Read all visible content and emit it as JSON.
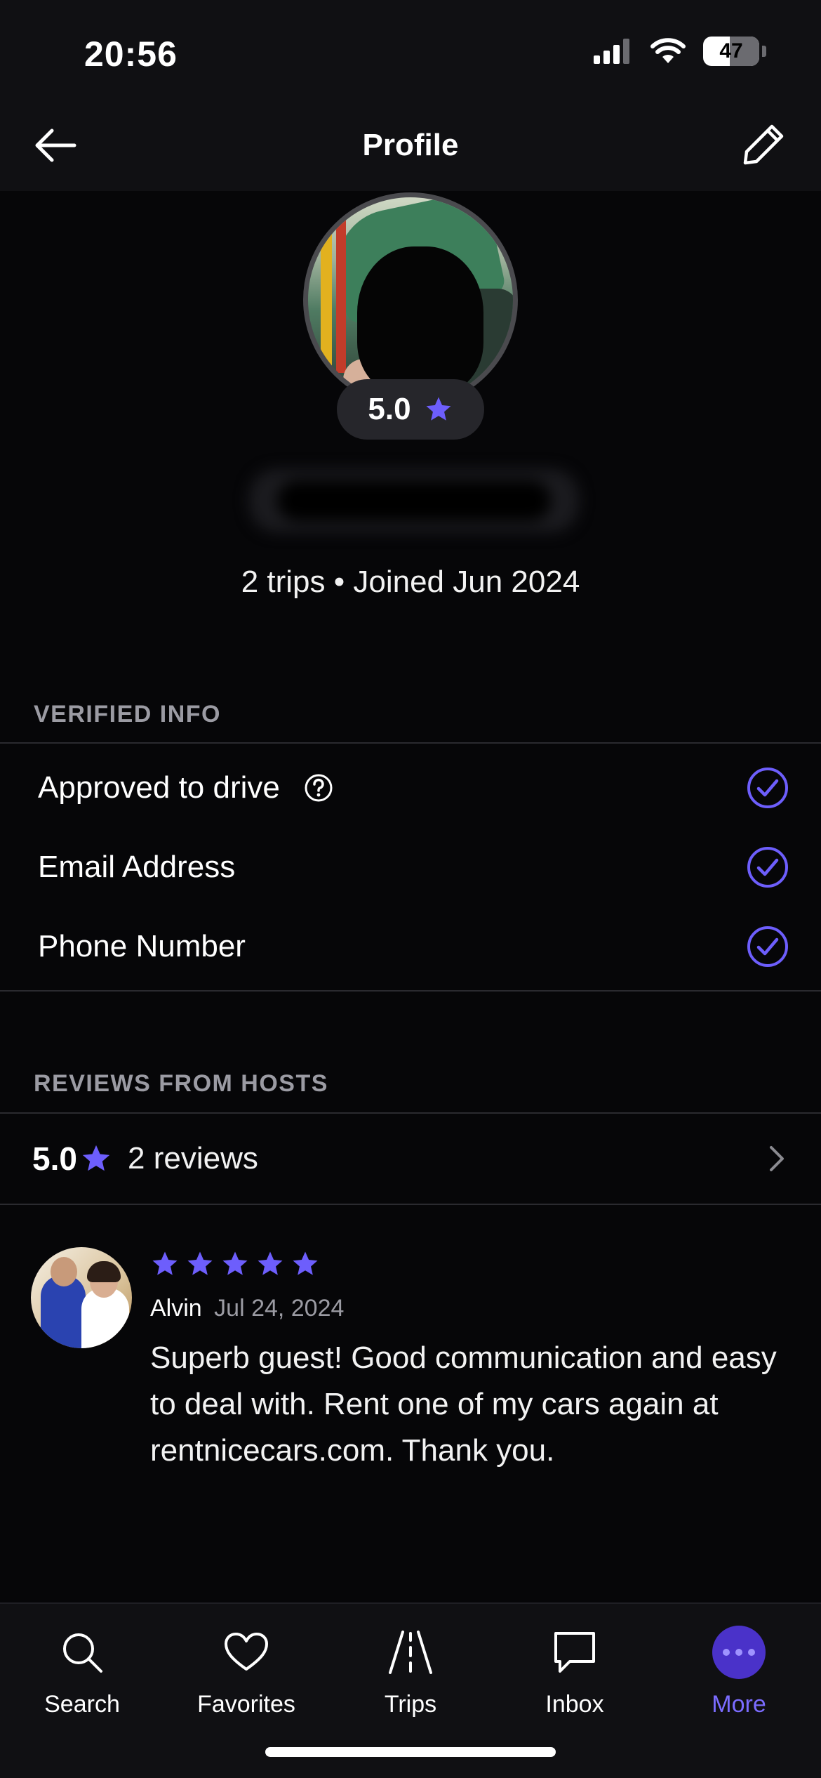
{
  "status_bar": {
    "time": "20:56",
    "battery": "47",
    "battery_level_percent": 47
  },
  "header": {
    "title": "Profile",
    "back_icon": "arrow-left-icon",
    "edit_icon": "pencil-icon"
  },
  "profile": {
    "rating": "5.0",
    "stats": "2 trips • Joined Jun 2024"
  },
  "verified": {
    "heading": "VERIFIED INFO",
    "items": [
      {
        "label": "Approved to drive",
        "has_help": true,
        "verified": true
      },
      {
        "label": "Email Address",
        "has_help": false,
        "verified": true
      },
      {
        "label": "Phone Number",
        "has_help": false,
        "verified": true
      }
    ]
  },
  "reviews": {
    "heading": "REVIEWS FROM HOSTS",
    "average": "5.0",
    "count_label": "2 reviews",
    "items": [
      {
        "stars": 5,
        "author": "Alvin",
        "date": "Jul 24, 2024",
        "text": "Superb guest! Good communication and easy to deal with. Rent one of my cars again at rentnicecars.com. Thank you."
      }
    ]
  },
  "tabbar": {
    "tabs": [
      {
        "label": "Search",
        "icon": "search-icon",
        "active": false
      },
      {
        "label": "Favorites",
        "icon": "heart-icon",
        "active": false
      },
      {
        "label": "Trips",
        "icon": "road-icon",
        "active": false
      },
      {
        "label": "Inbox",
        "icon": "chat-icon",
        "active": false
      },
      {
        "label": "More",
        "icon": "more-icon",
        "active": true
      }
    ]
  },
  "colors": {
    "accent": "#6d5efc",
    "background": "#060608",
    "surface": "#101013",
    "muted_text": "#9b9ba3"
  }
}
